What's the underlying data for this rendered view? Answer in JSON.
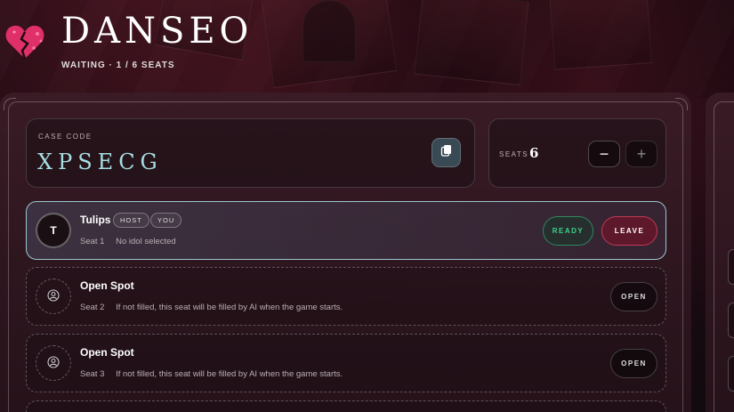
{
  "header": {
    "title": "DANSEO",
    "status": "WAITING · 1 / 6 SEATS"
  },
  "room": {
    "case_code_label": "CASE CODE",
    "case_code": "XPSECG",
    "seats_label": "SEATS",
    "seats_value": "6",
    "decrement_label": "−",
    "increment_label": "+"
  },
  "seats": [
    {
      "avatar": "T",
      "name": "Tulips",
      "badges": [
        "HOST",
        "YOU"
      ],
      "seat": "Seat 1",
      "detail": "No idol selected",
      "ready_label": "READY",
      "leave_label": "LEAVE"
    },
    {
      "name": "Open Spot",
      "seat": "Seat 2",
      "detail": "If not filled, this seat will be filled by AI when the game starts.",
      "action_label": "OPEN"
    },
    {
      "name": "Open Spot",
      "seat": "Seat 3",
      "detail": "If not filled, this seat will be filled by AI when the game starts.",
      "action_label": "OPEN"
    }
  ],
  "colors": {
    "accent_code": "#a6dde2",
    "ready": "#3fcf8a",
    "leave": "#c23a55",
    "host_border": "#9ec5cf"
  },
  "icons": [
    "broken-heart-logo-icon",
    "copy-icon",
    "person-icon"
  ]
}
